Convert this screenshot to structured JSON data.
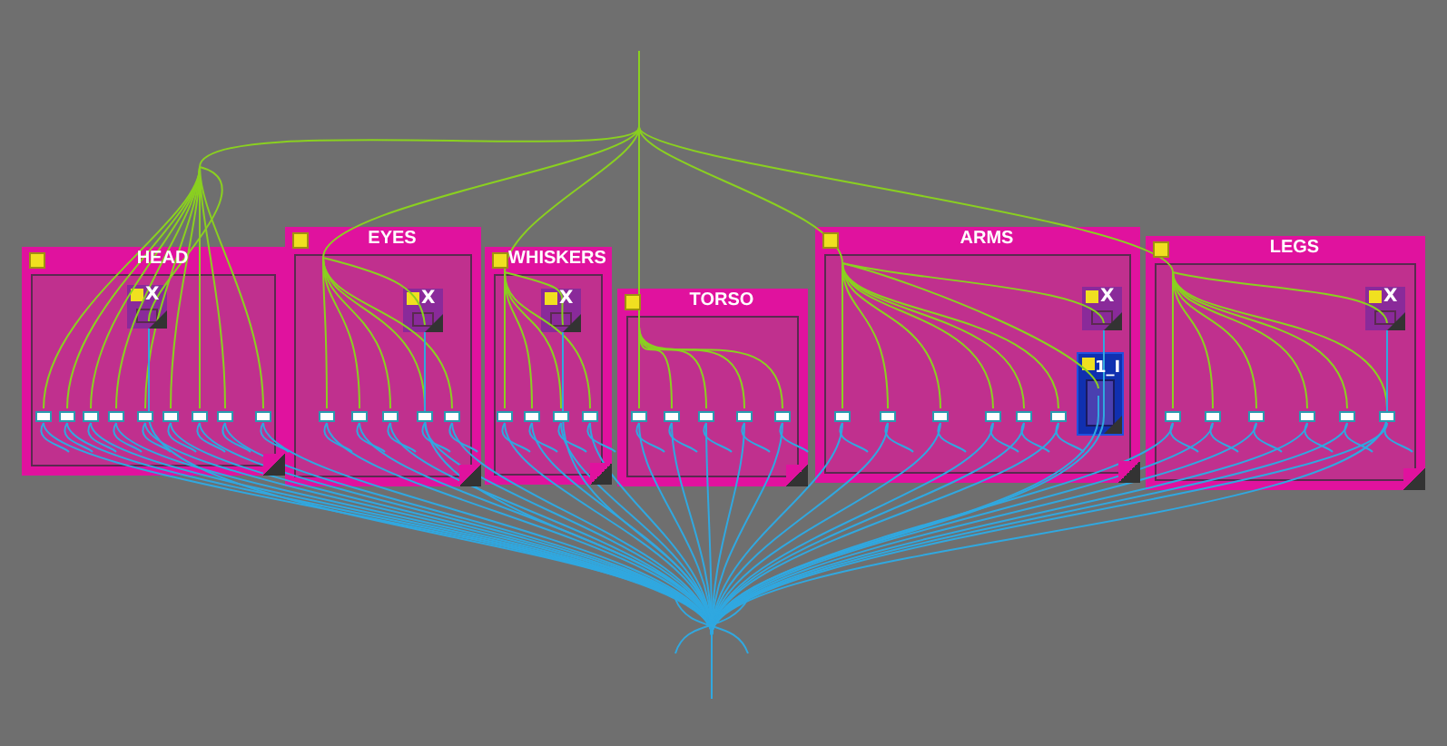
{
  "canvas": {
    "groups": [
      {
        "title": "HEAD",
        "nodes": [
          {
            "kind": "small",
            "label": "X"
          }
        ]
      },
      {
        "title": "EYES",
        "nodes": [
          {
            "kind": "small",
            "label": "X"
          }
        ]
      },
      {
        "title": "WHISKERS",
        "nodes": [
          {
            "kind": "small",
            "label": "X"
          }
        ]
      },
      {
        "title": "TORSO"
      },
      {
        "title": "ARMS",
        "nodes": [
          {
            "kind": "small",
            "label": "X"
          },
          {
            "kind": "block",
            "label": "1_I"
          }
        ]
      },
      {
        "title": "LEGS",
        "nodes": [
          {
            "kind": "small",
            "label": "X"
          }
        ]
      }
    ]
  }
}
